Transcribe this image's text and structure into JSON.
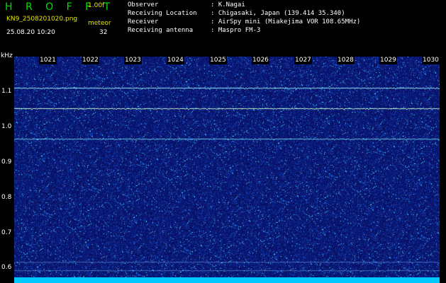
{
  "header": {
    "logo": "H R O F F T",
    "version": "1.00f",
    "filename": "KN9_2508201020.png",
    "datetime": "25.08.20 10:20",
    "meteor_label": "meteor",
    "meteor_count": "32"
  },
  "info": [
    {
      "key": "Observer",
      "value": ": K.Nagai"
    },
    {
      "key": "Receiving Location",
      "value": ": Chigasaki, Japan (139.414 35.340)"
    },
    {
      "key": "Receiver",
      "value": ": AirSpy mini (Miakejima VOR 108.65MHz)"
    },
    {
      "key": "Receiving antenna",
      "value": ": Maspro FM-3"
    }
  ],
  "axis": {
    "y_unit": "kHz",
    "y_ticks": [
      "1.1",
      "1.0",
      "0.9",
      "0.8",
      "0.7",
      "0.6"
    ],
    "x_ticks": [
      "1021",
      "1022",
      "1023",
      "1024",
      "1025",
      "1026",
      "1027",
      "1028",
      "1029",
      "1030"
    ]
  },
  "colors": {
    "background": "#000000",
    "plot": "#0a1a78",
    "signal": "#7ff0ff",
    "logo": "#00e000",
    "accent": "#e8e800"
  }
}
